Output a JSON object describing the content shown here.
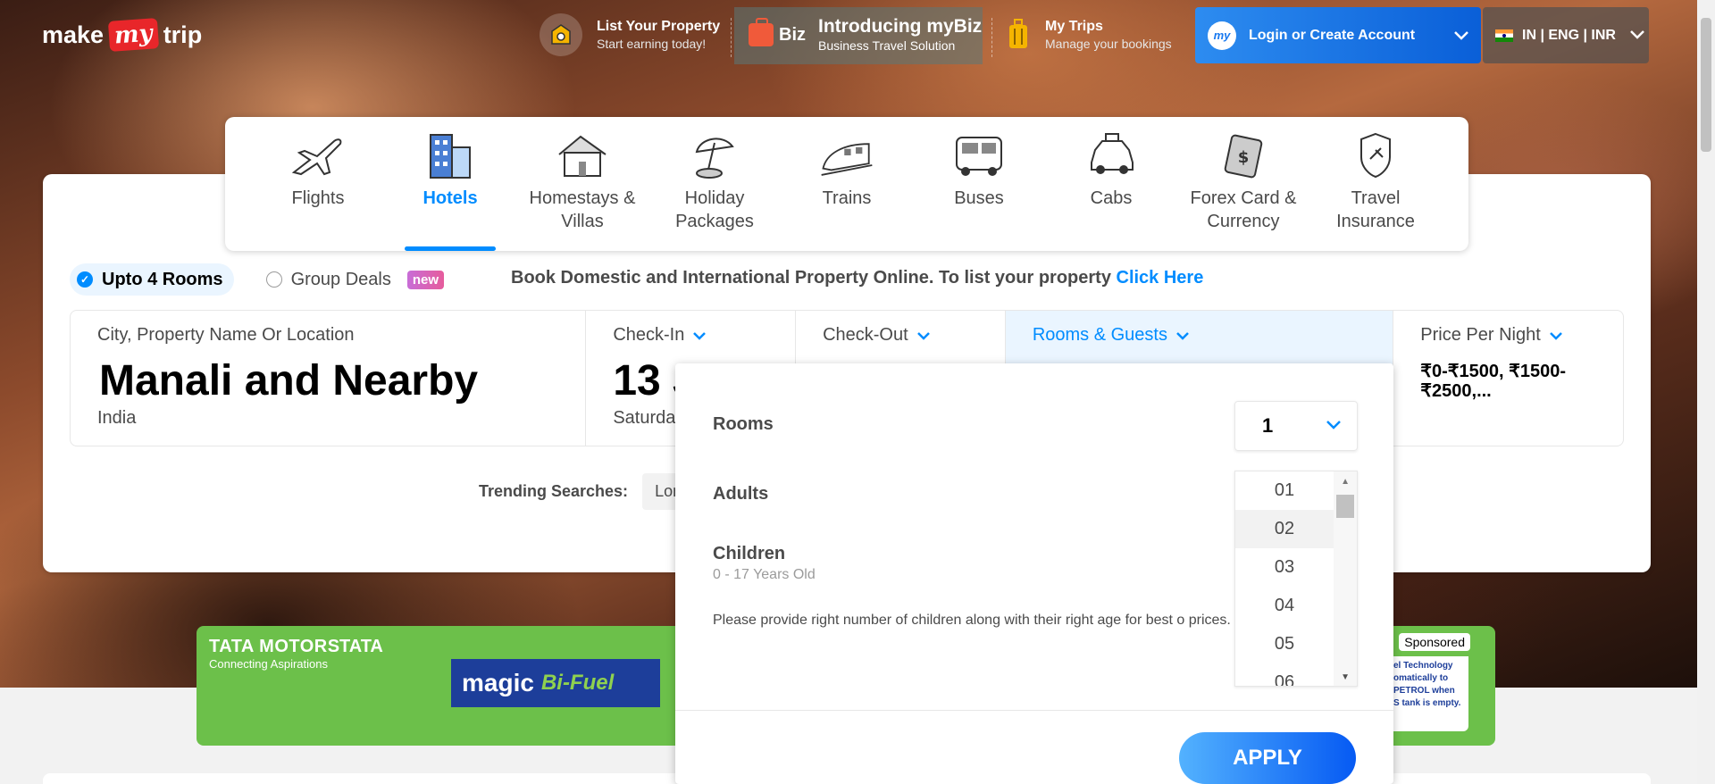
{
  "header": {
    "logo_make": "make",
    "logo_my": "my",
    "logo_trip": "trip",
    "list_property": {
      "title": "List Your Property",
      "sub": "Start earning today!"
    },
    "mybiz": {
      "logo": "Biz",
      "title": "Introducing myBiz",
      "sub": "Business Travel Solution"
    },
    "my_trips": {
      "title": "My Trips",
      "sub": "Manage your bookings"
    },
    "login": {
      "icon_text": "my",
      "label": "Login or Create Account"
    },
    "locale": "IN | ENG | INR"
  },
  "categories": [
    {
      "label": "Flights",
      "icon": "plane-icon"
    },
    {
      "label": "Hotels",
      "icon": "hotel-icon",
      "active": true
    },
    {
      "label": "Homestays & Villas",
      "icon": "house-icon"
    },
    {
      "label": "Holiday Packages",
      "icon": "umbrella-icon"
    },
    {
      "label": "Trains",
      "icon": "train-icon"
    },
    {
      "label": "Buses",
      "icon": "bus-icon"
    },
    {
      "label": "Cabs",
      "icon": "car-icon"
    },
    {
      "label": "Forex Card & Currency",
      "icon": "forex-icon"
    },
    {
      "label": "Travel Insurance",
      "icon": "insurance-icon"
    }
  ],
  "room_type": {
    "upto4": "Upto 4 Rooms",
    "group": "Group Deals",
    "new_badge": "new",
    "list_text": "Book Domestic and International Property Online. To list your property ",
    "list_link": "Click Here"
  },
  "search": {
    "city_label": "City, Property Name Or Location",
    "city_value": "Manali and Nearby",
    "city_sub": "India",
    "checkin_label": "Check-In",
    "checkin_value": "13 J",
    "checkin_sub": "Saturda",
    "checkout_label": "Check-Out",
    "rooms_label": "Rooms & Guests",
    "price_label": "Price Per Night",
    "price_value": "₹0-₹1500, ₹1500-₹2500,..."
  },
  "trending": {
    "label": "Trending Searches:",
    "chip": "Lond"
  },
  "rooms_panel": {
    "rooms_label": "Rooms",
    "rooms_value": "1",
    "adults_label": "Adults",
    "children_label": "Children",
    "children_sub": "0 - 17 Years Old",
    "note": "Please provide right number of children along with their right age for best o prices.",
    "adult_options": [
      "01",
      "02",
      "03",
      "04",
      "05",
      "06"
    ],
    "apply": "APPLY"
  },
  "ad": {
    "tata_motors": "TATA MOTORS",
    "tagline": "Connecting Aspirations",
    "tata": "TATA",
    "magic": "magic",
    "bifuel": "Bi-Fuel",
    "sponsored": "Sponsored",
    "right_text": "el Technology omatically to PETROL when S tank is empty."
  },
  "colors": {
    "accent": "#008cff",
    "brand_red": "#e8262a",
    "ad_green": "#6cc04a"
  }
}
